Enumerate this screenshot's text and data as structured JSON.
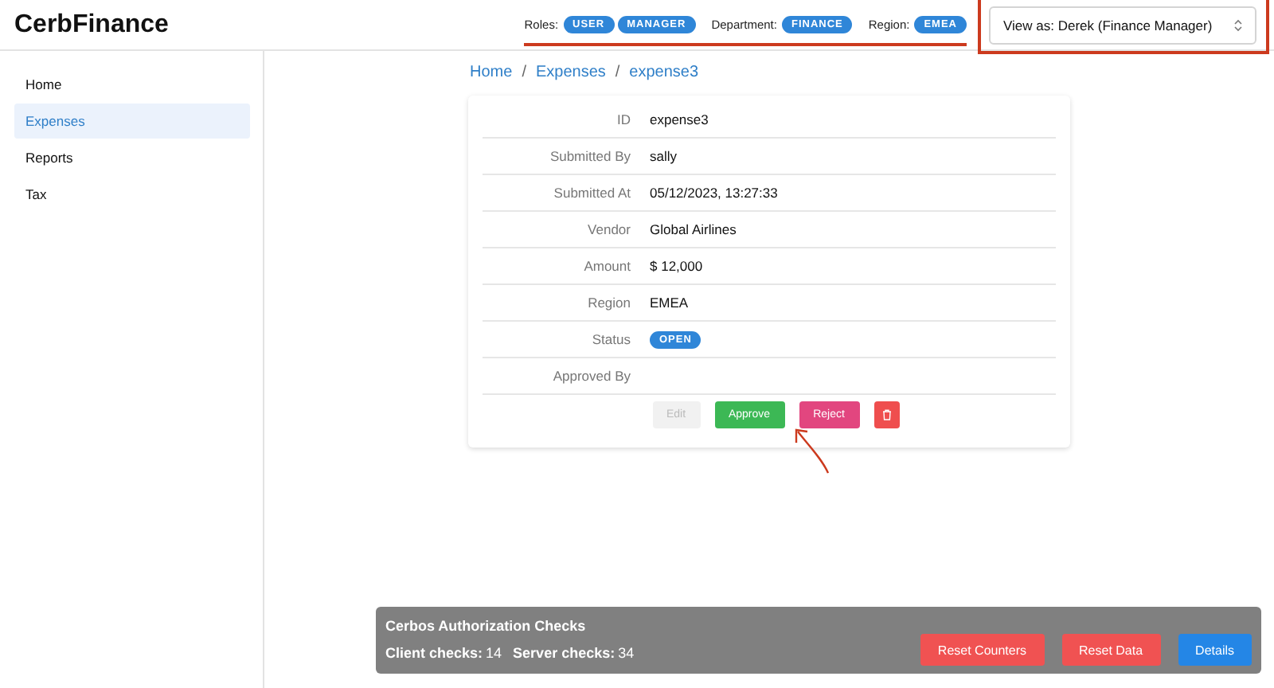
{
  "app": {
    "title": "CerbFinance"
  },
  "header": {
    "filters": [
      {
        "label": "Roles:",
        "badges": [
          "USER",
          "MANAGER"
        ]
      },
      {
        "label": "Department:",
        "badges": [
          "FINANCE"
        ]
      },
      {
        "label": "Region:",
        "badges": [
          "EMEA"
        ]
      }
    ],
    "view_as": {
      "value": "View as: Derek (Finance Manager)"
    }
  },
  "sidebar": {
    "items": [
      {
        "label": "Home",
        "selected": false
      },
      {
        "label": "Expenses",
        "selected": true
      },
      {
        "label": "Reports",
        "selected": false
      },
      {
        "label": "Tax",
        "selected": false
      }
    ]
  },
  "breadcrumb": {
    "items": [
      "Home",
      "Expenses",
      "expense3"
    ],
    "separator": "/"
  },
  "expense": {
    "fields": [
      {
        "label": "ID",
        "value": "expense3",
        "kind": "text"
      },
      {
        "label": "Submitted By",
        "value": "sally",
        "kind": "text"
      },
      {
        "label": "Submitted At",
        "value": "05/12/2023, 13:27:33",
        "kind": "text"
      },
      {
        "label": "Vendor",
        "value": "Global Airlines",
        "kind": "text"
      },
      {
        "label": "Amount",
        "value": "$ 12,000",
        "kind": "text"
      },
      {
        "label": "Region",
        "value": "EMEA",
        "kind": "text"
      },
      {
        "label": "Status",
        "value": "OPEN",
        "kind": "badge"
      },
      {
        "label": "Approved By"
      }
    ],
    "actions": [
      {
        "label": "Edit",
        "kind": "edit",
        "disabled": true
      },
      {
        "label": "Approve",
        "kind": "approve",
        "disabled": false
      },
      {
        "label": "Reject",
        "kind": "reject",
        "disabled": false
      },
      {
        "kind": "delete",
        "disabled": false
      }
    ]
  },
  "checks": {
    "title": "Cerbos Authorization Checks",
    "counters": [
      {
        "label": "Client checks:",
        "value": "14"
      },
      {
        "label": "Server checks:",
        "value": "34"
      }
    ],
    "buttons": [
      {
        "label": "Reset Counters",
        "kind": "danger"
      },
      {
        "label": "Reset Data",
        "kind": "danger"
      },
      {
        "label": "Details",
        "kind": "primary"
      }
    ]
  }
}
